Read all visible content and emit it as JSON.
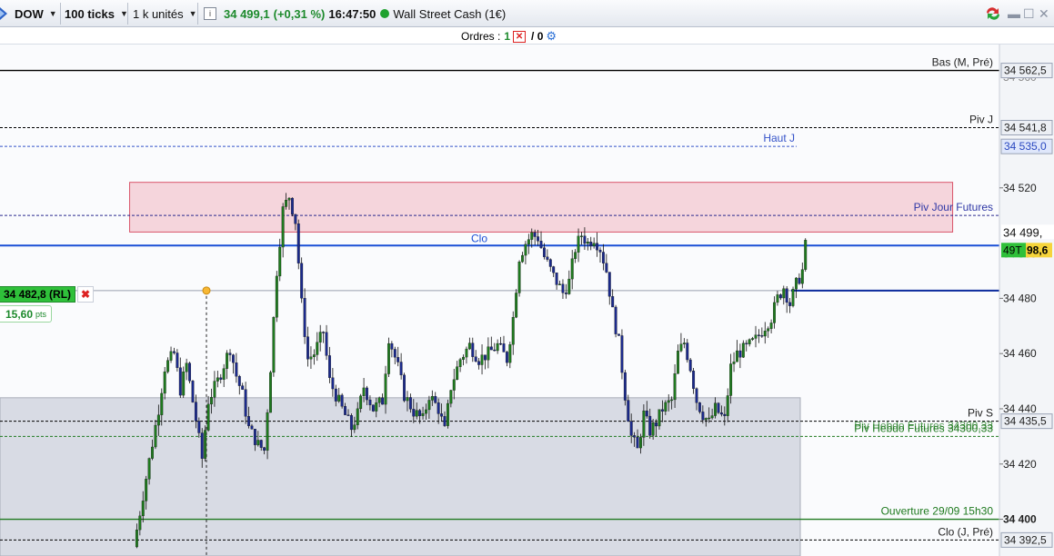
{
  "toolbar": {
    "instrument": "DOW",
    "ticks": "100 ticks",
    "units": "1 k unités",
    "price": "34 499,1",
    "change": "(+0,31 %)",
    "time": "16:47:50",
    "market_name": "Wall Street Cash (1€)"
  },
  "orders": {
    "label": "Ordres :",
    "count_a": "1",
    "count_b": "/ 0"
  },
  "position": {
    "label": "34 482,8 (RL)",
    "pts": "15,60",
    "pts_unit": "pts"
  },
  "axis": {
    "current_price": "34 499,",
    "current_badge_left": "49T",
    "current_badge_right": "98,6",
    "clipped_tick_1": "34 560",
    "clipped_tick_2": "34 500",
    "ticks": [
      {
        "label": "34 520",
        "price": 34520,
        "bold": false
      },
      {
        "label": "34 480",
        "price": 34480,
        "bold": false
      },
      {
        "label": "34 460",
        "price": 34460,
        "bold": false
      },
      {
        "label": "34 440",
        "price": 34440,
        "bold": false
      },
      {
        "label": "34 420",
        "price": 34420,
        "bold": false
      },
      {
        "label": "34 400",
        "price": 34400,
        "bold": true
      }
    ]
  },
  "levels": [
    {
      "key": "bas_m_pre",
      "label": "Bas (M, Pré)",
      "price_label": "34 562,5",
      "price": 34562.5,
      "style": "solid",
      "color": "#000000",
      "label_color": "#222222",
      "box": "#eceff4"
    },
    {
      "key": "piv_j",
      "label": "Piv J",
      "price_label": "34 541,8",
      "price": 34541.8,
      "style": "dashed",
      "color": "#000000",
      "label_color": "#222222",
      "box": "#eceff4"
    },
    {
      "key": "haut_j",
      "label": "Haut J",
      "price_label": "34 535,0",
      "price": 34535.0,
      "style": "dashed",
      "color": "#3553c9",
      "label_color": "#3553c9",
      "box": "#dfe7fb"
    },
    {
      "key": "piv_jour_futures",
      "label": "Piv Jour Futures",
      "price": 34510,
      "style": "dashed",
      "color": "#2b2b8f",
      "label_color": "#2f38a6"
    },
    {
      "key": "piv_s",
      "label": "Piv S",
      "price_label": "34 435,5",
      "price": 34435.5,
      "style": "dashed",
      "color": "#000000",
      "label_color": "#222222",
      "box": "#eceff4"
    },
    {
      "key": "piv_hebdo_futures",
      "label": "Piv Hebdo Futures 34300,33",
      "label_overlap": "Piv Hebdo Futures 34300,33",
      "price": 34430,
      "style": "dashed",
      "color": "#1f7a1f",
      "label_color": "#1f7a1f"
    },
    {
      "key": "ouverture",
      "label": "Ouverture 29/09 15h30",
      "price": 34400,
      "style": "solid",
      "color": "#1f7a1f",
      "label_color": "#1f7a1f"
    },
    {
      "key": "clo_j_pre",
      "label": "Clo (J, Pré)",
      "price_label": "34 392,5",
      "price": 34392.5,
      "style": "dashed",
      "color": "#000000",
      "label_color": "#222222",
      "box": "#eceff4"
    }
  ],
  "clo_label": "Clo",
  "colors": {
    "up": "#1f7a1f",
    "down": "#1b2a8c",
    "current": "#1a4fd6",
    "position_line": "#0a2a9c",
    "pink_zone": "#f5d5dc",
    "gray_zone": "#d3d6e0",
    "pos_badge": "#2fc03a"
  },
  "chart_data": {
    "type": "candlestick",
    "instrument": "DOW",
    "x_unit": "100 ticks",
    "ylim": [
      34388,
      34572
    ],
    "current_price": 34499.1,
    "path": [
      [
        0,
        34390
      ],
      [
        8,
        34440
      ],
      [
        10,
        34455
      ],
      [
        13,
        34460
      ],
      [
        15,
        34447
      ],
      [
        17,
        34456
      ],
      [
        20,
        34436
      ],
      [
        22,
        34422
      ],
      [
        24,
        34443
      ],
      [
        27,
        34450
      ],
      [
        31,
        34462
      ],
      [
        33,
        34452
      ],
      [
        35,
        34445
      ],
      [
        37,
        34433
      ],
      [
        40,
        34427
      ],
      [
        42,
        34425
      ],
      [
        44,
        34455
      ],
      [
        46,
        34490
      ],
      [
        48,
        34512
      ],
      [
        50,
        34517
      ],
      [
        52,
        34508
      ],
      [
        54,
        34478
      ],
      [
        56,
        34458
      ],
      [
        58,
        34460
      ],
      [
        61,
        34468
      ],
      [
        63,
        34450
      ],
      [
        65,
        34445
      ],
      [
        67,
        34440
      ],
      [
        70,
        34433
      ],
      [
        72,
        34438
      ],
      [
        74,
        34448
      ],
      [
        77,
        34440
      ],
      [
        80,
        34443
      ],
      [
        82,
        34466
      ],
      [
        85,
        34455
      ],
      [
        87,
        34445
      ],
      [
        90,
        34439
      ],
      [
        93,
        34436
      ],
      [
        95,
        34445
      ],
      [
        98,
        34440
      ],
      [
        100,
        34432
      ],
      [
        102,
        34448
      ],
      [
        105,
        34458
      ],
      [
        108,
        34463
      ],
      [
        111,
        34458
      ],
      [
        114,
        34460
      ],
      [
        117,
        34463
      ],
      [
        120,
        34458
      ],
      [
        122,
        34473
      ],
      [
        124,
        34495
      ],
      [
        126,
        34500
      ],
      [
        128,
        34503
      ],
      [
        130,
        34502
      ],
      [
        132,
        34495
      ],
      [
        135,
        34488
      ],
      [
        138,
        34482
      ],
      [
        140,
        34486
      ],
      [
        142,
        34498
      ],
      [
        144,
        34503
      ],
      [
        146,
        34500
      ],
      [
        148,
        34502
      ],
      [
        150,
        34498
      ],
      [
        152,
        34490
      ],
      [
        154,
        34475
      ],
      [
        156,
        34464
      ],
      [
        158,
        34445
      ],
      [
        160,
        34430
      ],
      [
        162,
        34425
      ],
      [
        164,
        34438
      ],
      [
        166,
        34432
      ],
      [
        168,
        34435
      ],
      [
        170,
        34440
      ],
      [
        173,
        34443
      ],
      [
        175,
        34460
      ],
      [
        177,
        34464
      ],
      [
        179,
        34455
      ],
      [
        181,
        34443
      ],
      [
        183,
        34438
      ],
      [
        185,
        34435
      ],
      [
        187,
        34440
      ],
      [
        190,
        34436
      ],
      [
        192,
        34455
      ],
      [
        194,
        34460
      ],
      [
        197,
        34462
      ],
      [
        200,
        34465
      ],
      [
        203,
        34470
      ],
      [
        205,
        34473
      ],
      [
        207,
        34480
      ],
      [
        209,
        34484
      ],
      [
        211,
        34478
      ],
      [
        213,
        34485
      ],
      [
        215,
        34490
      ],
      [
        216,
        34499
      ]
    ],
    "levels": [
      {
        "name": "Bas (M, Pré)",
        "value": 34562.5
      },
      {
        "name": "Piv J",
        "value": 34541.8
      },
      {
        "name": "Haut J",
        "value": 34535.0
      },
      {
        "name": "Piv Jour Futures",
        "value": 34510
      },
      {
        "name": "34 482,8 (RL)",
        "value": 34482.8
      },
      {
        "name": "Piv S",
        "value": 34435.5
      },
      {
        "name": "Piv Hebdo Futures 34300,33",
        "value": 34430
      },
      {
        "name": "Ouverture 29/09 15h30",
        "value": 34400
      },
      {
        "name": "Clo (J, Pré)",
        "value": 34392.5
      }
    ],
    "zones": [
      {
        "name": "resistance",
        "from": 34504,
        "to": 34522,
        "x_from": 18,
        "x_to": 218
      },
      {
        "name": "support",
        "from": 34380,
        "to": 34444,
        "x_from": 0,
        "x_to": 217
      }
    ]
  }
}
